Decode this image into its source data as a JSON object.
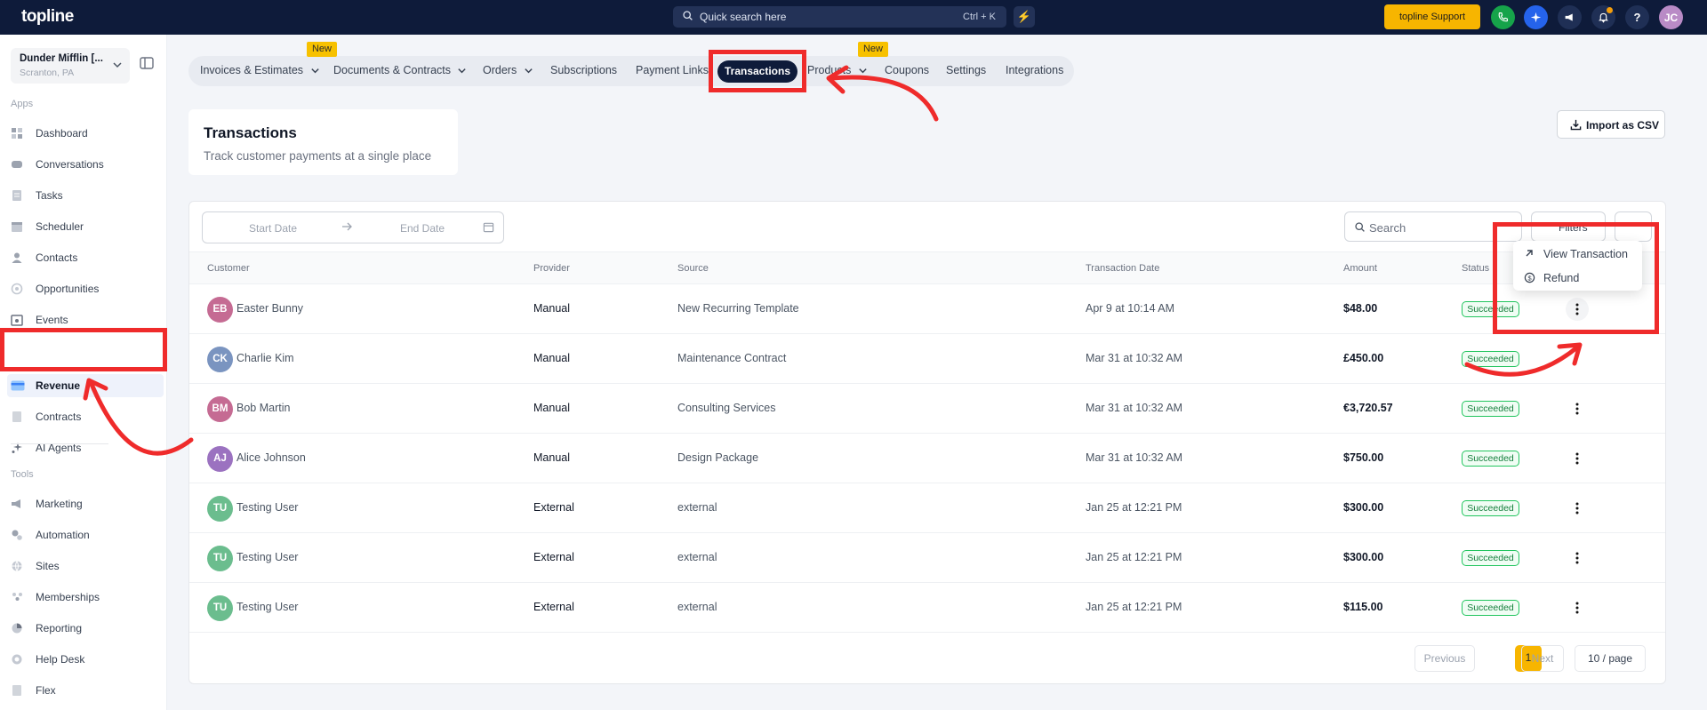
{
  "topbar": {
    "logo": "topline",
    "search_placeholder": "Quick search here",
    "search_shortcut": "Ctrl + K",
    "support_label": "topline Support",
    "avatar_initials": "JC"
  },
  "sidebar": {
    "location_name": "Dunder Mifflin [...",
    "location_sub": "Scranton, PA",
    "apps_label": "Apps",
    "tools_label": "Tools",
    "apps": [
      {
        "label": "Dashboard",
        "icon": "dashboard-icon"
      },
      {
        "label": "Conversations",
        "icon": "chat-icon"
      },
      {
        "label": "Tasks",
        "icon": "tasks-icon"
      },
      {
        "label": "Scheduler",
        "icon": "calendar-icon"
      },
      {
        "label": "Contacts",
        "icon": "person-icon"
      },
      {
        "label": "Opportunities",
        "icon": "target-icon"
      },
      {
        "label": "Events",
        "icon": "event-icon"
      },
      {
        "label": "Revenue",
        "icon": "card-icon",
        "active": true
      },
      {
        "label": "Contracts",
        "icon": "document-icon"
      },
      {
        "label": "AI Agents",
        "icon": "sparkle-icon"
      }
    ],
    "tools": [
      {
        "label": "Marketing",
        "icon": "megaphone-icon"
      },
      {
        "label": "Automation",
        "icon": "gears-icon"
      },
      {
        "label": "Sites",
        "icon": "globe-icon"
      },
      {
        "label": "Memberships",
        "icon": "members-icon"
      },
      {
        "label": "Reporting",
        "icon": "pie-icon"
      },
      {
        "label": "Help Desk",
        "icon": "help-icon"
      },
      {
        "label": "Flex",
        "icon": "flex-icon"
      }
    ]
  },
  "tabs": {
    "items": [
      "Invoices & Estimates",
      "Documents & Contracts",
      "Orders",
      "Subscriptions",
      "Payment Links",
      "Transactions",
      "Products",
      "Coupons",
      "Settings",
      "Integrations"
    ],
    "active": "Transactions",
    "new_badge": "New"
  },
  "header": {
    "title": "Transactions",
    "subtitle": "Track customer payments at a single place",
    "import_label": "Import as CSV"
  },
  "toolbar": {
    "start_date": "Start Date",
    "end_date": "End Date",
    "search_placeholder": "Search",
    "filters_label": "Filters"
  },
  "table": {
    "columns": [
      "Customer",
      "Provider",
      "Source",
      "Transaction Date",
      "Amount",
      "Status"
    ],
    "rows": [
      {
        "initials": "EB",
        "customer": "Easter Bunny",
        "provider": "Manual",
        "source": "New Recurring Template",
        "date": "Apr 9 at 10:14 AM",
        "amount": "$48.00",
        "status": "Succeeded",
        "avatar_color": "#c56b93"
      },
      {
        "initials": "CK",
        "customer": "Charlie Kim",
        "provider": "Manual",
        "source": "Maintenance Contract",
        "date": "Mar 31 at 10:32 AM",
        "amount": "£450.00",
        "status": "Succeeded",
        "avatar_color": "#7a94c0"
      },
      {
        "initials": "BM",
        "customer": "Bob Martin",
        "provider": "Manual",
        "source": "Consulting Services",
        "date": "Mar 31 at 10:32 AM",
        "amount": "€3,720.57",
        "status": "Succeeded",
        "avatar_color": "#c56b93"
      },
      {
        "initials": "AJ",
        "customer": "Alice Johnson",
        "provider": "Manual",
        "source": "Design Package",
        "date": "Mar 31 at 10:32 AM",
        "amount": "$750.00",
        "status": "Succeeded",
        "avatar_color": "#9b72c0"
      },
      {
        "initials": "TU",
        "customer": "Testing User",
        "provider": "External",
        "source": "external",
        "date": "Jan 25 at 12:21 PM",
        "amount": "$300.00",
        "status": "Succeeded",
        "avatar_color": "#6bbd8e"
      },
      {
        "initials": "TU",
        "customer": "Testing User",
        "provider": "External",
        "source": "external",
        "date": "Jan 25 at 12:21 PM",
        "amount": "$300.00",
        "status": "Succeeded",
        "avatar_color": "#6bbd8e"
      },
      {
        "initials": "TU",
        "customer": "Testing User",
        "provider": "External",
        "source": "external",
        "date": "Jan 25 at 12:21 PM",
        "amount": "$115.00",
        "status": "Succeeded",
        "avatar_color": "#6bbd8e"
      }
    ]
  },
  "row_menu": {
    "view_label": "View Transaction",
    "refund_label": "Refund"
  },
  "pagination": {
    "previous": "Previous",
    "current_page": "1",
    "next": "Next",
    "page_size": "10 / page"
  },
  "colors": {
    "accent": "#f7b500",
    "navy": "#0e1b3a",
    "annotation": "#ef2b2b",
    "success": "#22c55e"
  }
}
